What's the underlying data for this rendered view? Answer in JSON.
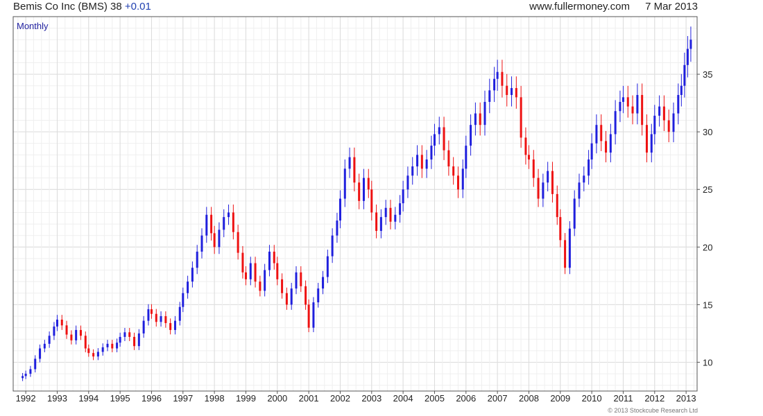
{
  "header": {
    "title": "Bemis Co Inc (BMS) 38",
    "change": "+0.01",
    "site": "www.fullermoney.com",
    "date": "7 Mar 2013"
  },
  "copyright": "© 2013 Stockcube Research Ltd",
  "colors": {
    "up": "#1f1fdd",
    "down": "#ee1111",
    "grid": "#dcdcdc",
    "border": "#555555"
  },
  "chart_data": {
    "type": "candlestick",
    "period_label": "Monthly",
    "x_tick_labels": [
      "1992",
      "1993",
      "1994",
      "1995",
      "1996",
      "1997",
      "1998",
      "1999",
      "2000",
      "2001",
      "2002",
      "2003",
      "2004",
      "2005",
      "2006",
      "2007",
      "2008",
      "2009",
      "2010",
      "2011",
      "2012",
      "2013"
    ],
    "y_tick_labels": [
      10,
      15,
      20,
      25,
      30,
      35
    ],
    "ylim": [
      7.5,
      40
    ],
    "xlim": [
      1991.6,
      2013.35
    ],
    "grid": true,
    "y_axis_side": "right",
    "series": [
      {
        "x": 1991.9,
        "close": 8.8
      },
      {
        "x": 1992.0,
        "close": 9.0
      },
      {
        "x": 1992.15,
        "close": 9.4
      },
      {
        "x": 1992.3,
        "close": 10.3
      },
      {
        "x": 1992.45,
        "close": 11.2
      },
      {
        "x": 1992.6,
        "close": 11.6
      },
      {
        "x": 1992.75,
        "close": 12.3
      },
      {
        "x": 1992.9,
        "close": 13.1
      },
      {
        "x": 1993.0,
        "close": 13.7
      },
      {
        "x": 1993.15,
        "close": 13.2
      },
      {
        "x": 1993.3,
        "close": 12.4
      },
      {
        "x": 1993.45,
        "close": 11.9
      },
      {
        "x": 1993.6,
        "close": 12.8
      },
      {
        "x": 1993.75,
        "close": 12.3
      },
      {
        "x": 1993.9,
        "close": 11.2
      },
      {
        "x": 1994.0,
        "close": 10.8
      },
      {
        "x": 1994.15,
        "close": 10.5
      },
      {
        "x": 1994.3,
        "close": 10.9
      },
      {
        "x": 1994.45,
        "close": 11.3
      },
      {
        "x": 1994.6,
        "close": 11.6
      },
      {
        "x": 1994.75,
        "close": 11.2
      },
      {
        "x": 1994.9,
        "close": 11.7
      },
      {
        "x": 1995.0,
        "close": 12.2
      },
      {
        "x": 1995.15,
        "close": 12.6
      },
      {
        "x": 1995.3,
        "close": 12.2
      },
      {
        "x": 1995.45,
        "close": 11.4
      },
      {
        "x": 1995.6,
        "close": 12.5
      },
      {
        "x": 1995.75,
        "close": 13.6
      },
      {
        "x": 1995.9,
        "close": 14.6
      },
      {
        "x": 1996.0,
        "close": 14.2
      },
      {
        "x": 1996.15,
        "close": 13.5
      },
      {
        "x": 1996.3,
        "close": 14.0
      },
      {
        "x": 1996.45,
        "close": 13.4
      },
      {
        "x": 1996.6,
        "close": 12.8
      },
      {
        "x": 1996.75,
        "close": 13.6
      },
      {
        "x": 1996.9,
        "close": 14.8
      },
      {
        "x": 1997.0,
        "close": 16.0
      },
      {
        "x": 1997.15,
        "close": 17.0
      },
      {
        "x": 1997.3,
        "close": 18.2
      },
      {
        "x": 1997.45,
        "close": 19.6
      },
      {
        "x": 1997.6,
        "close": 21.0
      },
      {
        "x": 1997.75,
        "close": 22.8
      },
      {
        "x": 1997.9,
        "close": 21.2
      },
      {
        "x": 1998.0,
        "close": 20.0
      },
      {
        "x": 1998.15,
        "close": 21.5
      },
      {
        "x": 1998.3,
        "close": 22.6
      },
      {
        "x": 1998.45,
        "close": 23.0
      },
      {
        "x": 1998.6,
        "close": 21.3
      },
      {
        "x": 1998.75,
        "close": 19.5
      },
      {
        "x": 1998.9,
        "close": 17.8
      },
      {
        "x": 1999.0,
        "close": 17.2
      },
      {
        "x": 1999.15,
        "close": 18.6
      },
      {
        "x": 1999.3,
        "close": 17.0
      },
      {
        "x": 1999.45,
        "close": 16.2
      },
      {
        "x": 1999.6,
        "close": 18.0
      },
      {
        "x": 1999.75,
        "close": 19.6
      },
      {
        "x": 1999.9,
        "close": 18.6
      },
      {
        "x": 2000.0,
        "close": 17.2
      },
      {
        "x": 2000.15,
        "close": 16.0
      },
      {
        "x": 2000.3,
        "close": 15.0
      },
      {
        "x": 2000.45,
        "close": 16.4
      },
      {
        "x": 2000.6,
        "close": 17.8
      },
      {
        "x": 2000.75,
        "close": 16.6
      },
      {
        "x": 2000.9,
        "close": 15.0
      },
      {
        "x": 2001.0,
        "close": 13.0
      },
      {
        "x": 2001.15,
        "close": 15.2
      },
      {
        "x": 2001.3,
        "close": 16.4
      },
      {
        "x": 2001.45,
        "close": 17.4
      },
      {
        "x": 2001.6,
        "close": 19.2
      },
      {
        "x": 2001.75,
        "close": 21.0
      },
      {
        "x": 2001.9,
        "close": 22.3
      },
      {
        "x": 2002.0,
        "close": 24.2
      },
      {
        "x": 2002.15,
        "close": 26.8
      },
      {
        "x": 2002.3,
        "close": 27.8
      },
      {
        "x": 2002.45,
        "close": 25.6
      },
      {
        "x": 2002.6,
        "close": 24.0
      },
      {
        "x": 2002.75,
        "close": 26.0
      },
      {
        "x": 2002.9,
        "close": 25.0
      },
      {
        "x": 2003.0,
        "close": 23.0
      },
      {
        "x": 2003.15,
        "close": 21.4
      },
      {
        "x": 2003.3,
        "close": 22.6
      },
      {
        "x": 2003.45,
        "close": 23.4
      },
      {
        "x": 2003.6,
        "close": 22.2
      },
      {
        "x": 2003.75,
        "close": 22.8
      },
      {
        "x": 2003.9,
        "close": 23.8
      },
      {
        "x": 2004.0,
        "close": 25.0
      },
      {
        "x": 2004.15,
        "close": 26.2
      },
      {
        "x": 2004.3,
        "close": 27.0
      },
      {
        "x": 2004.45,
        "close": 28.0
      },
      {
        "x": 2004.6,
        "close": 26.8
      },
      {
        "x": 2004.75,
        "close": 27.6
      },
      {
        "x": 2004.9,
        "close": 28.8
      },
      {
        "x": 2005.0,
        "close": 29.8
      },
      {
        "x": 2005.15,
        "close": 30.4
      },
      {
        "x": 2005.3,
        "close": 28.4
      },
      {
        "x": 2005.45,
        "close": 27.0
      },
      {
        "x": 2005.6,
        "close": 26.2
      },
      {
        "x": 2005.75,
        "close": 25.0
      },
      {
        "x": 2005.9,
        "close": 26.8
      },
      {
        "x": 2006.0,
        "close": 28.8
      },
      {
        "x": 2006.15,
        "close": 30.6
      },
      {
        "x": 2006.3,
        "close": 31.6
      },
      {
        "x": 2006.45,
        "close": 30.6
      },
      {
        "x": 2006.6,
        "close": 32.6
      },
      {
        "x": 2006.75,
        "close": 33.6
      },
      {
        "x": 2006.9,
        "close": 34.6
      },
      {
        "x": 2007.0,
        "close": 35.2
      },
      {
        "x": 2007.15,
        "close": 34.0
      },
      {
        "x": 2007.3,
        "close": 33.2
      },
      {
        "x": 2007.45,
        "close": 33.8
      },
      {
        "x": 2007.6,
        "close": 33.0
      },
      {
        "x": 2007.75,
        "close": 29.5
      },
      {
        "x": 2007.9,
        "close": 28.0
      },
      {
        "x": 2008.0,
        "close": 27.6
      },
      {
        "x": 2008.15,
        "close": 26.0
      },
      {
        "x": 2008.3,
        "close": 24.2
      },
      {
        "x": 2008.45,
        "close": 25.6
      },
      {
        "x": 2008.6,
        "close": 26.6
      },
      {
        "x": 2008.75,
        "close": 24.6
      },
      {
        "x": 2008.9,
        "close": 22.6
      },
      {
        "x": 2009.0,
        "close": 20.6
      },
      {
        "x": 2009.15,
        "close": 18.2
      },
      {
        "x": 2009.3,
        "close": 21.6
      },
      {
        "x": 2009.45,
        "close": 24.2
      },
      {
        "x": 2009.6,
        "close": 25.6
      },
      {
        "x": 2009.75,
        "close": 26.2
      },
      {
        "x": 2009.9,
        "close": 27.6
      },
      {
        "x": 2010.0,
        "close": 29.0
      },
      {
        "x": 2010.15,
        "close": 30.6
      },
      {
        "x": 2010.3,
        "close": 29.2
      },
      {
        "x": 2010.45,
        "close": 28.2
      },
      {
        "x": 2010.6,
        "close": 29.8
      },
      {
        "x": 2010.75,
        "close": 31.8
      },
      {
        "x": 2010.9,
        "close": 32.6
      },
      {
        "x": 2011.0,
        "close": 33.0
      },
      {
        "x": 2011.15,
        "close": 32.2
      },
      {
        "x": 2011.3,
        "close": 31.6
      },
      {
        "x": 2011.45,
        "close": 33.2
      },
      {
        "x": 2011.6,
        "close": 30.6
      },
      {
        "x": 2011.75,
        "close": 28.2
      },
      {
        "x": 2011.9,
        "close": 29.8
      },
      {
        "x": 2012.0,
        "close": 31.4
      },
      {
        "x": 2012.15,
        "close": 32.2
      },
      {
        "x": 2012.3,
        "close": 31.0
      },
      {
        "x": 2012.45,
        "close": 30.0
      },
      {
        "x": 2012.6,
        "close": 31.6
      },
      {
        "x": 2012.75,
        "close": 33.2
      },
      {
        "x": 2012.85,
        "close": 34.0
      },
      {
        "x": 2012.95,
        "close": 35.8
      },
      {
        "x": 2013.05,
        "close": 37.2
      },
      {
        "x": 2013.15,
        "close": 38.0
      }
    ]
  }
}
